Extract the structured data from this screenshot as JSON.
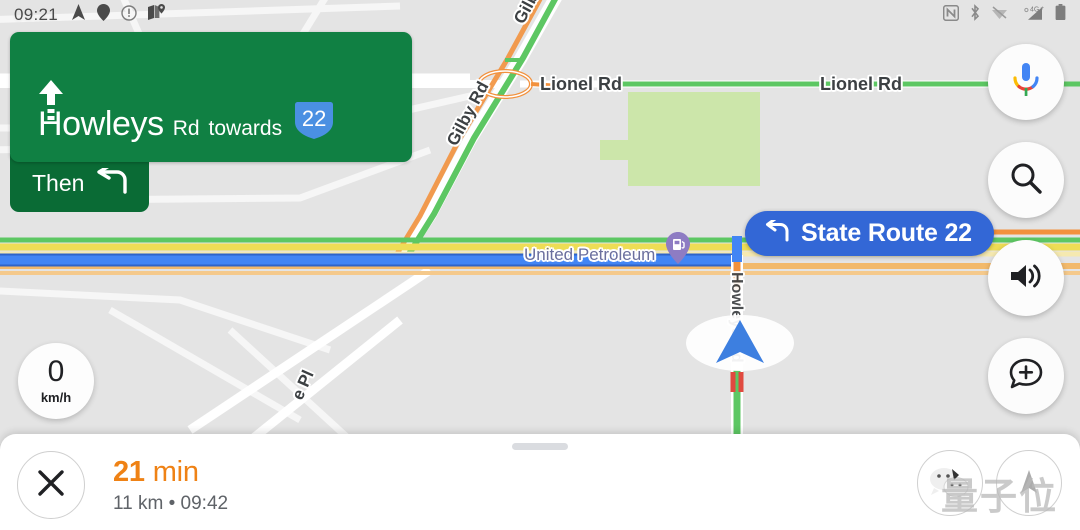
{
  "status_bar": {
    "time": "09:21",
    "left_icons": [
      "navigation-arrow-icon",
      "location-pin-icon",
      "alert-circle-icon",
      "maps-app-icon"
    ],
    "right_icons": [
      "nfc-icon",
      "bluetooth-icon",
      "wifi-off-icon",
      "signal-4g-plus-icon",
      "battery-icon"
    ],
    "network_label": "4G"
  },
  "maneuver": {
    "direction_icon": "straight-arrow-icon",
    "street": "Howleys",
    "street_type": "Rd",
    "towards_label": "towards",
    "shield_number": "22",
    "then_label": "Then",
    "then_icon": "turn-left-arrow-icon",
    "card_color": "#108043",
    "then_color": "#0a6b35"
  },
  "route_pill": {
    "label": "State Route 22",
    "icon": "turn-left-arrow-icon",
    "color": "#3367d6"
  },
  "side_buttons": [
    {
      "name": "google-assistant-mic-button",
      "icon": "google-mic-icon"
    },
    {
      "name": "search-button",
      "icon": "search-icon"
    },
    {
      "name": "volume-button",
      "icon": "volume-icon"
    },
    {
      "name": "add-report-button",
      "icon": "add-report-bubble-icon"
    }
  ],
  "speedometer": {
    "value": "0",
    "unit": "km/h"
  },
  "map": {
    "labels": [
      {
        "text": "Gilby Rd",
        "name": "map-label-gilby-rd-upper"
      },
      {
        "text": "Gilby Rd",
        "name": "map-label-gilby-rd-lower"
      },
      {
        "text": "Lionel Rd",
        "name": "map-label-lionel-rd-left"
      },
      {
        "text": "Lionel Rd",
        "name": "map-label-lionel-rd-right"
      },
      {
        "text": "Howleys Rd",
        "name": "map-label-howleys-rd"
      },
      {
        "text": "e Pl",
        "name": "map-label-e-pl"
      }
    ],
    "poi": {
      "name_label": "United Petroleum",
      "icon": "gas-station-pin-icon",
      "pin_color": "#8e7cc3"
    },
    "vehicle_marker": "navigation-chevron-icon",
    "route_color": "#4285f4",
    "traffic_colors": {
      "free": "#5dc763",
      "slow": "#f0d447",
      "heavy": "#f2913d"
    }
  },
  "bottom_sheet": {
    "close_icon": "close-icon",
    "eta_time": "21",
    "eta_unit": "min",
    "eta_detail": "11 km  •  09:42",
    "eta_color": "#ef8215",
    "avatars": [
      "avatar-wechat",
      "avatar-profile"
    ],
    "watermark": "量子位"
  }
}
